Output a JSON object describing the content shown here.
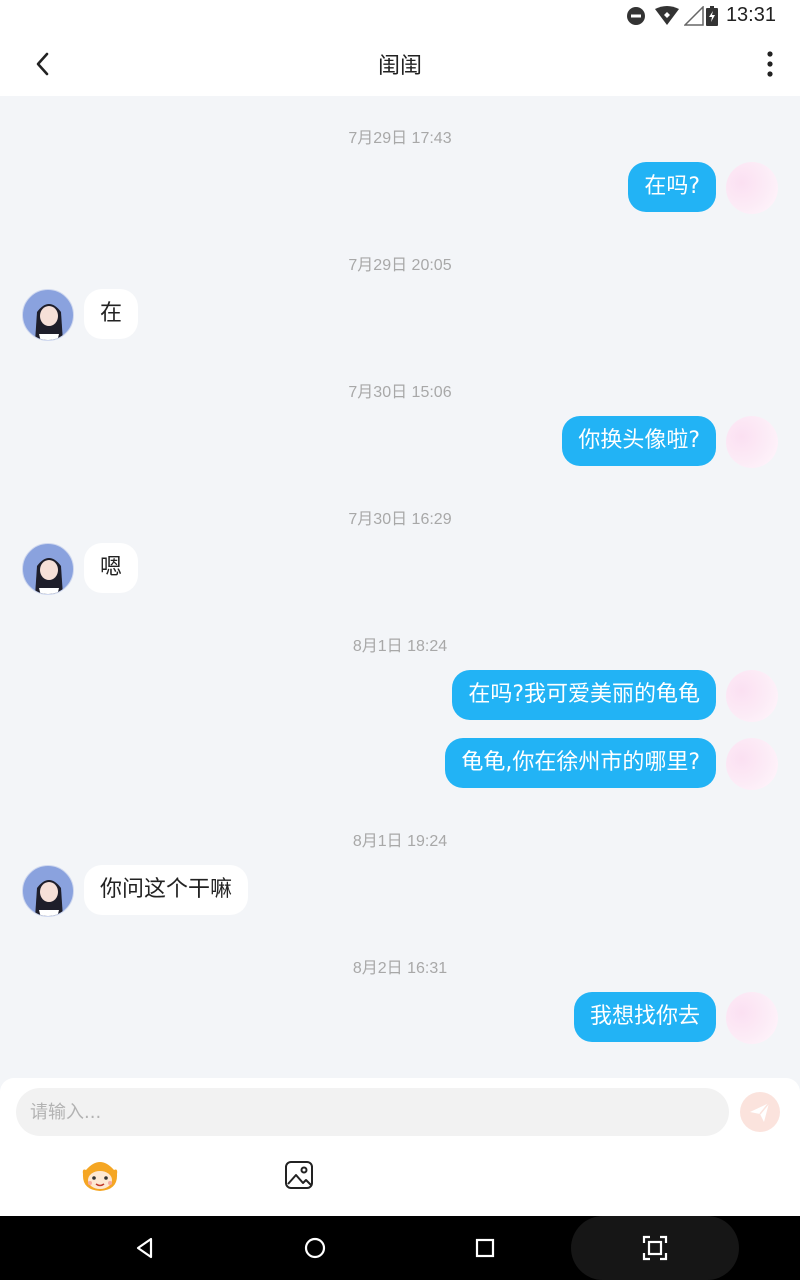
{
  "status_bar": {
    "time": "13:31"
  },
  "header": {
    "title": "闺闺"
  },
  "messages": [
    {
      "timestamp": "7月29日 17:43",
      "direction": "out",
      "texts": [
        "在吗?"
      ]
    },
    {
      "timestamp": "7月29日 20:05",
      "direction": "in",
      "texts": [
        "在"
      ]
    },
    {
      "timestamp": "7月30日 15:06",
      "direction": "out",
      "texts": [
        "你换头像啦?"
      ]
    },
    {
      "timestamp": "7月30日 16:29",
      "direction": "in",
      "texts": [
        "嗯"
      ]
    },
    {
      "timestamp": "8月1日 18:24",
      "direction": "out",
      "texts": [
        "在吗?我可爱美丽的龟龟",
        "龟龟,你在徐州市的哪里?"
      ]
    },
    {
      "timestamp": "8月1日 19:24",
      "direction": "in",
      "texts": [
        "你问这个干嘛"
      ]
    },
    {
      "timestamp": "8月2日 16:31",
      "direction": "out",
      "texts": [
        "我想找你去"
      ]
    }
  ],
  "input": {
    "placeholder": "请输入...",
    "value": ""
  },
  "colors": {
    "outgoing_bubble": "#22b3f5",
    "incoming_bubble": "#ffffff",
    "background": "#f3f5f8"
  }
}
